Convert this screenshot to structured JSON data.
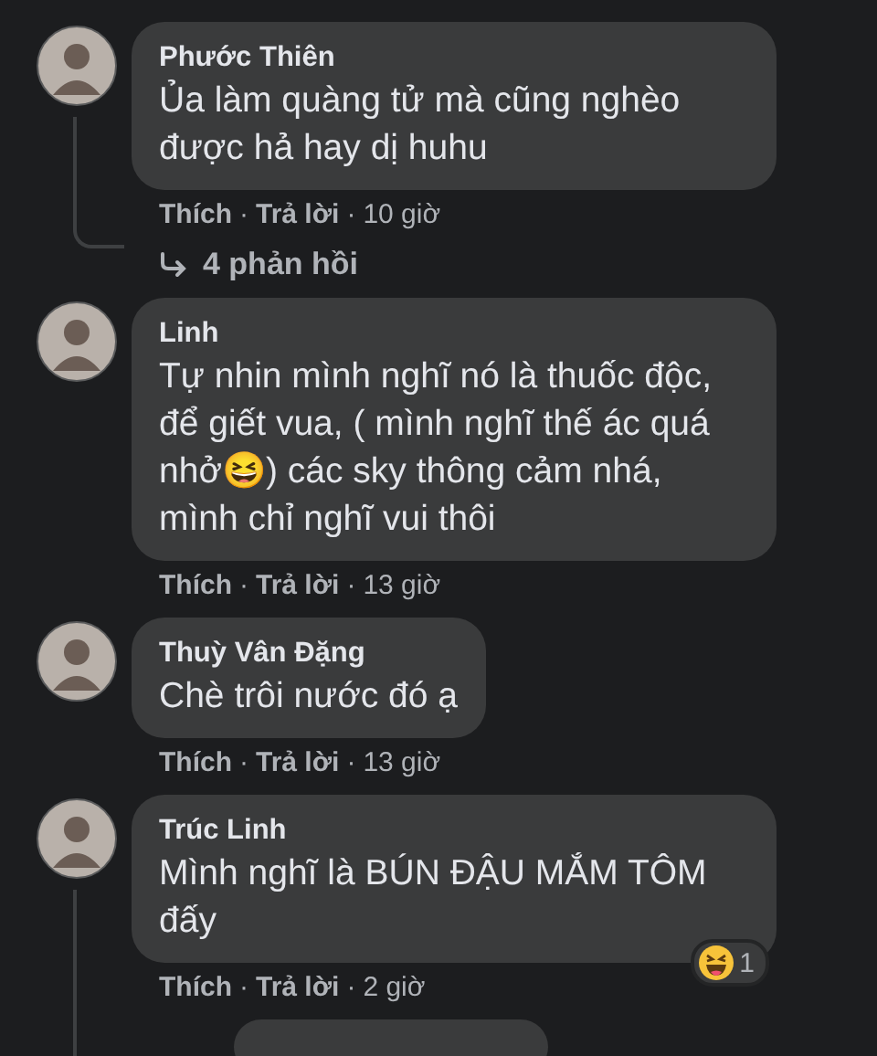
{
  "comments": [
    {
      "author": "Phước Thiên",
      "text": "Ủa làm quàng tử mà cũng nghèo được hả hay dị huhu",
      "like": "Thích",
      "separator": "·",
      "reply": "Trả lời",
      "time": "10 giờ",
      "replies": "4 phản hồi",
      "thread": true
    },
    {
      "author": "Linh",
      "text": "Tự nhin mình nghĩ nó là thuốc độc, để giết vua, ( mình nghĩ thế ác quá nhở😆) các sky thông cảm nhá, mình chỉ nghĩ vui thôi",
      "like": "Thích",
      "separator": "·",
      "reply": "Trả lời",
      "time": "13 giờ",
      "thread": false
    },
    {
      "author": "Thuỳ Vân Đặng",
      "text": "Chè trôi nước đó ạ",
      "like": "Thích",
      "separator": "·",
      "reply": "Trả lời",
      "time": "13 giờ",
      "thread": false
    },
    {
      "author": "Trúc Linh",
      "text": "Mình nghĩ là BÚN ĐẬU MẮM TÔM đấy",
      "like": "Thích",
      "separator": "·",
      "reply": "Trả lời",
      "time": "2 giờ",
      "reaction_count": "1",
      "thread": true
    }
  ]
}
